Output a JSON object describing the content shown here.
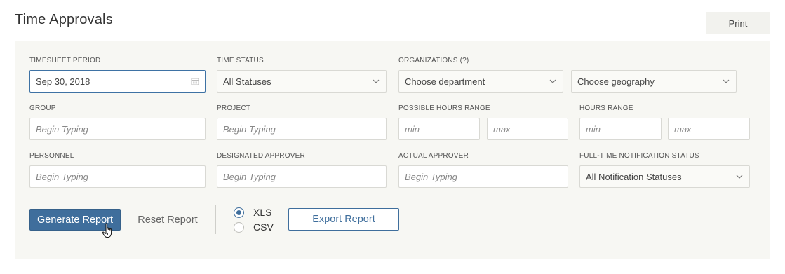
{
  "page": {
    "title": "Time Approvals",
    "print_label": "Print"
  },
  "filters": {
    "timesheet_period": {
      "label": "TIMESHEET PERIOD",
      "value": "Sep 30, 2018"
    },
    "time_status": {
      "label": "TIME STATUS",
      "value": "All Statuses"
    },
    "organizations": {
      "label": "ORGANIZATIONS (?)",
      "department": "Choose department",
      "geography": "Choose geography"
    },
    "group": {
      "label": "GROUP",
      "placeholder": "Begin Typing"
    },
    "project": {
      "label": "PROJECT",
      "placeholder": "Begin Typing"
    },
    "possible_hours_range": {
      "label": "POSSIBLE HOURS RANGE",
      "min_placeholder": "min",
      "max_placeholder": "max"
    },
    "hours_range": {
      "label": "HOURS RANGE",
      "min_placeholder": "min",
      "max_placeholder": "max"
    },
    "personnel": {
      "label": "PERSONNEL",
      "placeholder": "Begin Typing"
    },
    "designated_approver": {
      "label": "DESIGNATED APPROVER",
      "placeholder": "Begin Typing"
    },
    "actual_approver": {
      "label": "ACTUAL APPROVER",
      "placeholder": "Begin Typing"
    },
    "notification_status": {
      "label": "FULL-TIME NOTIFICATION STATUS",
      "value": "All Notification Statuses"
    }
  },
  "actions": {
    "generate_label": "Generate Report",
    "reset_label": "Reset Report",
    "export_label": "Export Report",
    "formats": [
      {
        "label": "XLS",
        "selected": true
      },
      {
        "label": "CSV",
        "selected": false
      }
    ]
  },
  "icons": {
    "calendar": "calendar-icon",
    "chevron": "chevron-down-icon",
    "cursor": "hand-pointer-icon"
  },
  "colors": {
    "primary": "#3f6e9c",
    "panel_bg": "#f7f7f3"
  }
}
